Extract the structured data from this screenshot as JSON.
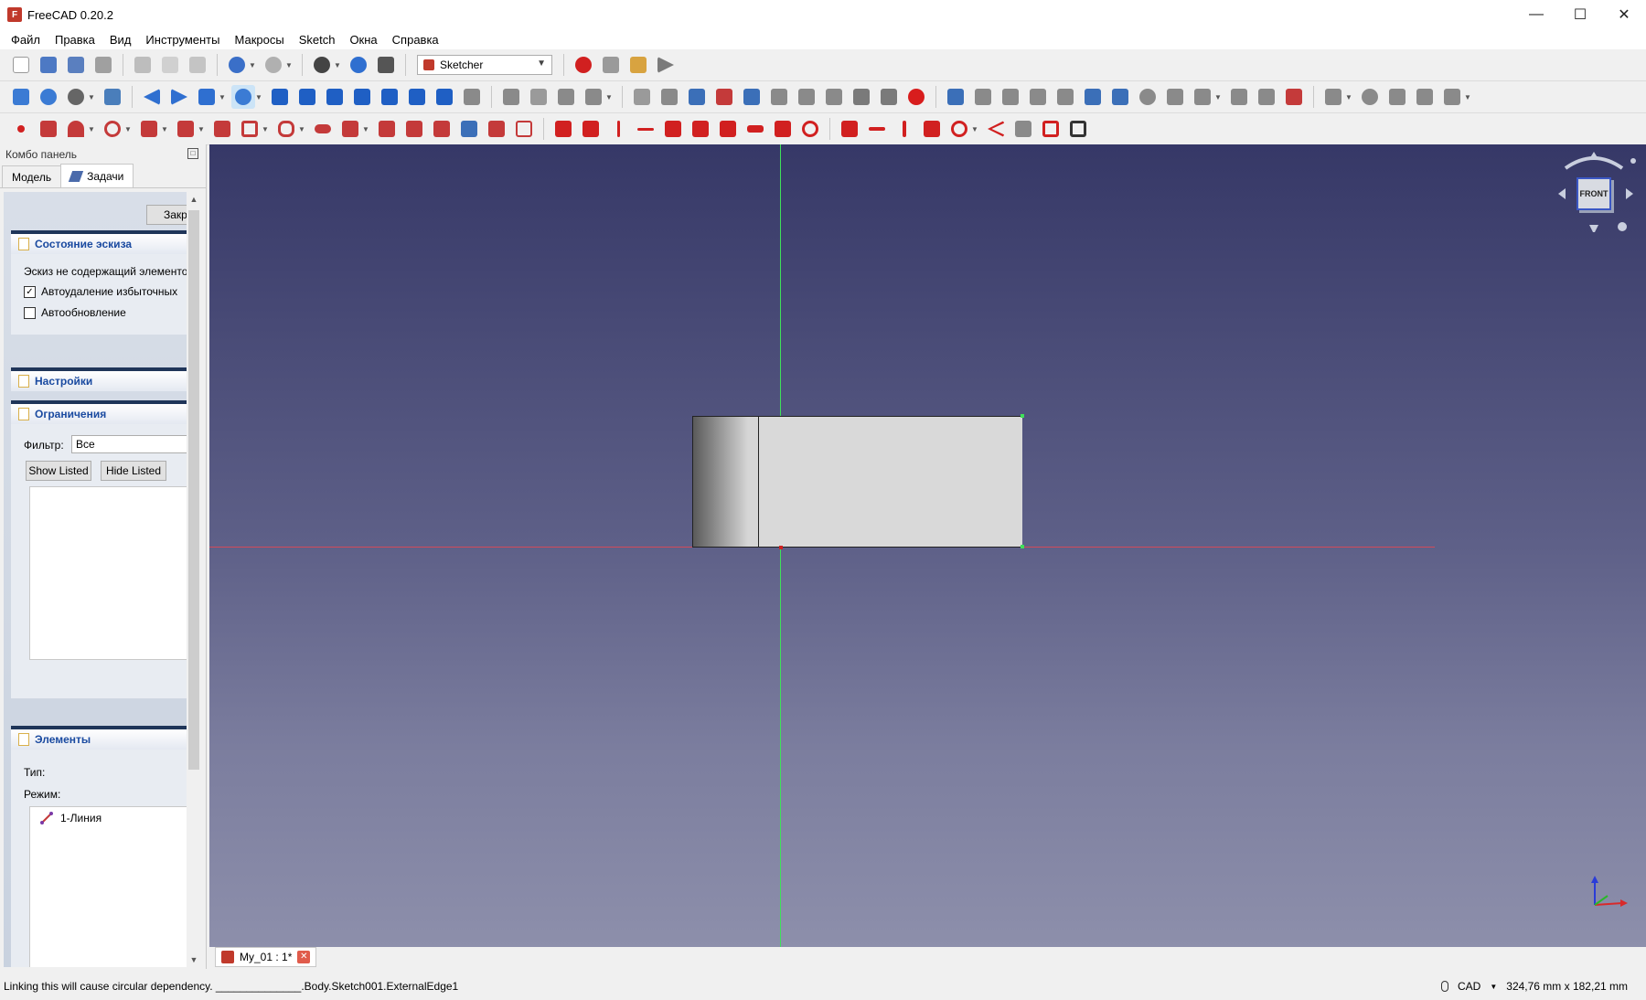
{
  "window": {
    "title": "FreeCAD 0.20.2",
    "app_icon_letter": "F"
  },
  "menu": [
    "Файл",
    "Правка",
    "Вид",
    "Инструменты",
    "Макросы",
    "Sketch",
    "Окна",
    "Справка"
  ],
  "toolbar": {
    "workbench": "Sketcher"
  },
  "combo": {
    "title": "Комбо панель",
    "tabs": [
      "Модель",
      "Задачи"
    ],
    "close_label": "Закр",
    "sketch_state": {
      "header": "Состояние эскиза",
      "message": "Эскиз не содержащий элементов",
      "auto_remove_label": "Автоудаление избыточных",
      "auto_remove_checked": true,
      "auto_update_label": "Автообновление",
      "auto_update_checked": false
    },
    "settings_header": "Настройки",
    "constraints": {
      "header": "Ограничения",
      "filter_label": "Фильтр:",
      "filter_value": "Все",
      "show_listed": "Show Listed",
      "hide_listed": "Hide Listed"
    },
    "elements": {
      "header": "Элементы",
      "type_label": "Тип:",
      "mode_label": "Режим:",
      "items": [
        "1-Линия"
      ]
    }
  },
  "viewport": {
    "navcube_face": "FRONT"
  },
  "doc_tab": {
    "label": "My_01 : 1*"
  },
  "status": {
    "message": "Linking this will cause circular dependency. ______________.Body.Sketch001.ExternalEdge1",
    "nav_style": "CAD",
    "dimensions": "324,76 mm x 182,21 mm"
  }
}
